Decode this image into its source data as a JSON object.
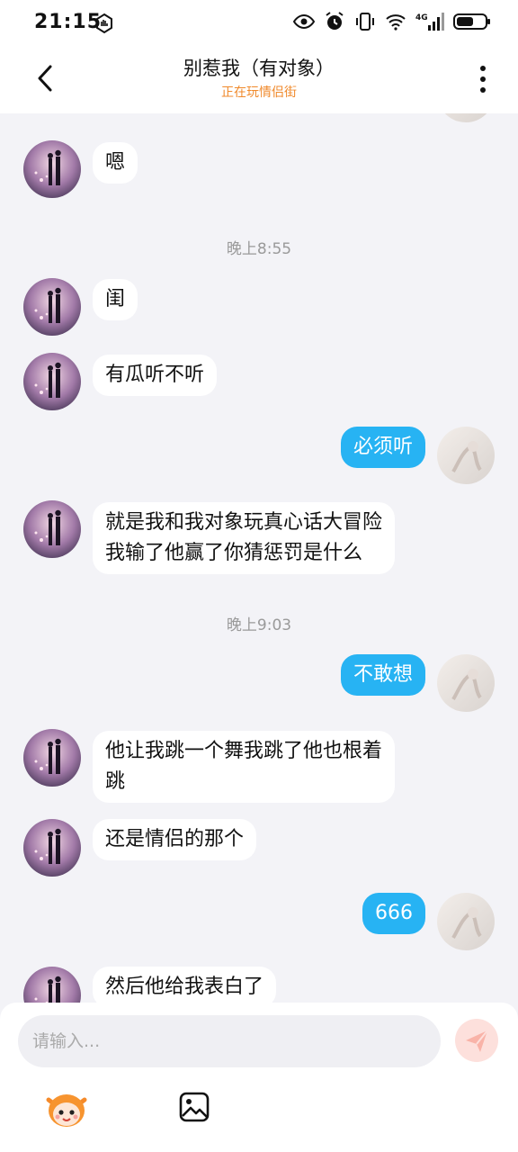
{
  "status_bar": {
    "time": "21:15",
    "icons": [
      "hand-icon",
      "eye-icon",
      "alarm-icon",
      "vibrate-icon",
      "wifi-icon",
      "4g-signal-icon",
      "battery-icon"
    ]
  },
  "header": {
    "title": "别惹我（有对象）",
    "subtitle": "正在玩情侣街",
    "accent_color": "#f08a2c"
  },
  "messages": [
    {
      "type": "in",
      "text": "嗯"
    },
    {
      "type": "time",
      "text": "晚上8:55"
    },
    {
      "type": "in",
      "text": "闺"
    },
    {
      "type": "in",
      "text": "有瓜听不听"
    },
    {
      "type": "out",
      "text": "必须听"
    },
    {
      "type": "in",
      "text": "就是我和我对象玩真心话大冒险",
      "text2": "我输了他赢了你猜惩罚是什么"
    },
    {
      "type": "time",
      "text": "晚上9:03"
    },
    {
      "type": "out",
      "text": "不敢想"
    },
    {
      "type": "in",
      "text": "他让我跳一个舞我跳了他也根着",
      "text2": "跳"
    },
    {
      "type": "in",
      "text": "还是情侣的那个"
    },
    {
      "type": "out",
      "text": "666"
    },
    {
      "type": "in",
      "text": "然后他给我表白了"
    }
  ],
  "input": {
    "placeholder": "请输入..."
  },
  "colors": {
    "outgoing_bubble": "#27b3f3",
    "incoming_bubble": "#ffffff",
    "background": "#f3f3f7"
  }
}
